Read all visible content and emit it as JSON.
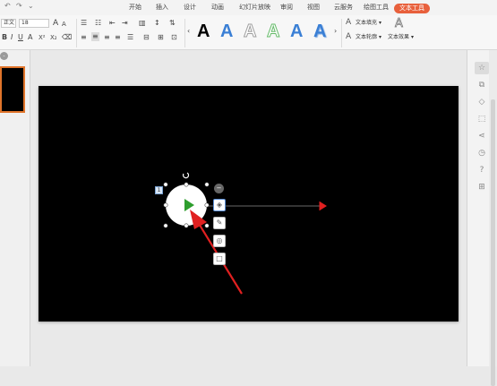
{
  "quick_access": {
    "undo_icon": "undo-icon",
    "redo_icon": "redo-icon",
    "customize_icon": "chevron-down-icon"
  },
  "menu": {
    "tabs": [
      {
        "label": "开始"
      },
      {
        "label": "插入"
      },
      {
        "label": "设计"
      },
      {
        "label": "动画"
      },
      {
        "label": "幻灯片放映"
      },
      {
        "label": "审阅"
      },
      {
        "label": "视图"
      },
      {
        "label": "云服务"
      },
      {
        "label": "绘图工具"
      },
      {
        "label": "文本工具"
      }
    ],
    "active_tab": "文本工具"
  },
  "ribbon": {
    "font_name": "正文",
    "font_size": "18",
    "grow_font": "A",
    "shrink_font": "A",
    "wordart_styles": [
      {
        "label": "A",
        "color": "#000000"
      },
      {
        "label": "A",
        "color": "#3a7fd5"
      },
      {
        "label": "A",
        "color": "#bdbdbd"
      },
      {
        "label": "A",
        "color": "#66bb6a"
      },
      {
        "label": "A",
        "color": "#3a7fd5"
      },
      {
        "label": "A",
        "color": "#3a7fd5"
      }
    ],
    "text_fill_label": "文本填充",
    "text_outline_label": "文本轮廓",
    "text_effect_label": "文本效果"
  },
  "thumbnails": {
    "collapse": "-"
  },
  "selection": {
    "animation_badge": "1"
  },
  "colors": {
    "slide_bg": "#000000",
    "accent_tab": "#e8603c",
    "play_triangle": "#2e9e2e",
    "arrow_red": "#e02020"
  }
}
